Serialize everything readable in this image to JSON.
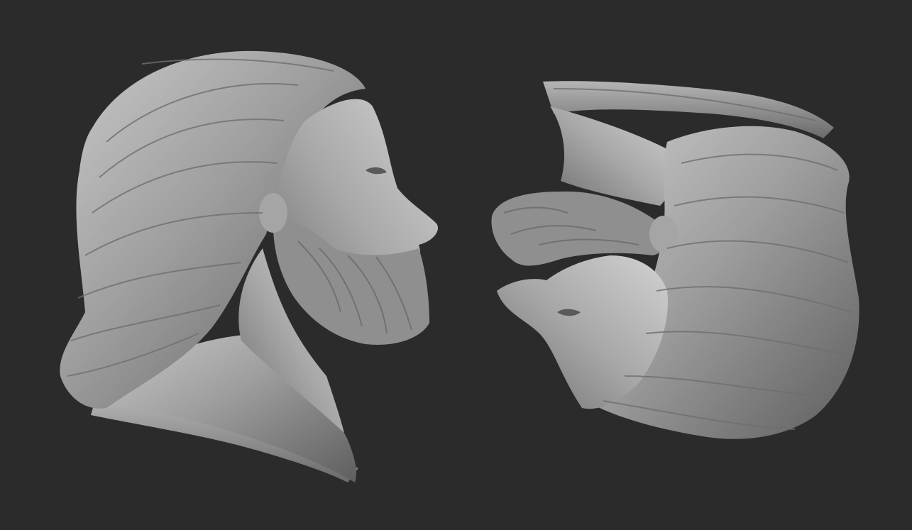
{
  "viewport": {
    "background_color": "#2b2b2b",
    "model_base_color": "#9a9a9a",
    "model_highlight_color": "#c8c8c8",
    "model_shadow_color": "#4a4a4a"
  },
  "models": [
    {
      "name": "bearded-man-profile-right",
      "orientation": "upright"
    },
    {
      "name": "bearded-man-profile-inverted",
      "orientation": "flipped"
    }
  ]
}
